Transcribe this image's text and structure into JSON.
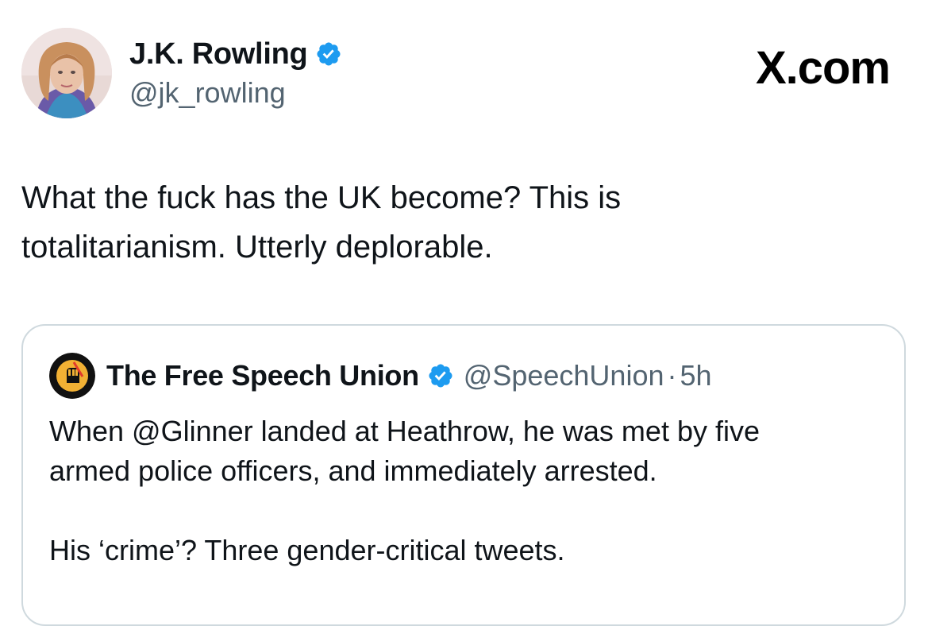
{
  "author": {
    "display_name": "J.K. Rowling",
    "handle": "@jk_rowling",
    "verified_icon": "verified-badge-icon",
    "avatar_icon": "profile-photo"
  },
  "brand": {
    "label": "X.com"
  },
  "tweet": {
    "line1": "What the fuck has the UK become? This is",
    "line2": "totalitarianism. Utterly deplorable."
  },
  "quoted_tweet": {
    "display_name": "The Free Speech Union",
    "handle": "@SpeechUnion",
    "separator": "·",
    "time": "5h",
    "avatar_icon": "raised-fist-logo",
    "paragraph1_line1": "When @Glinner landed at Heathrow, he was met by five",
    "paragraph1_line2": "armed police officers, and immediately arrested.",
    "paragraph2": "His ‘crime’? Three gender-critical tweets."
  },
  "colors": {
    "text_primary": "#0f1419",
    "text_secondary": "#536471",
    "verified_blue": "#1d9bf0",
    "border": "#cfd9de"
  }
}
